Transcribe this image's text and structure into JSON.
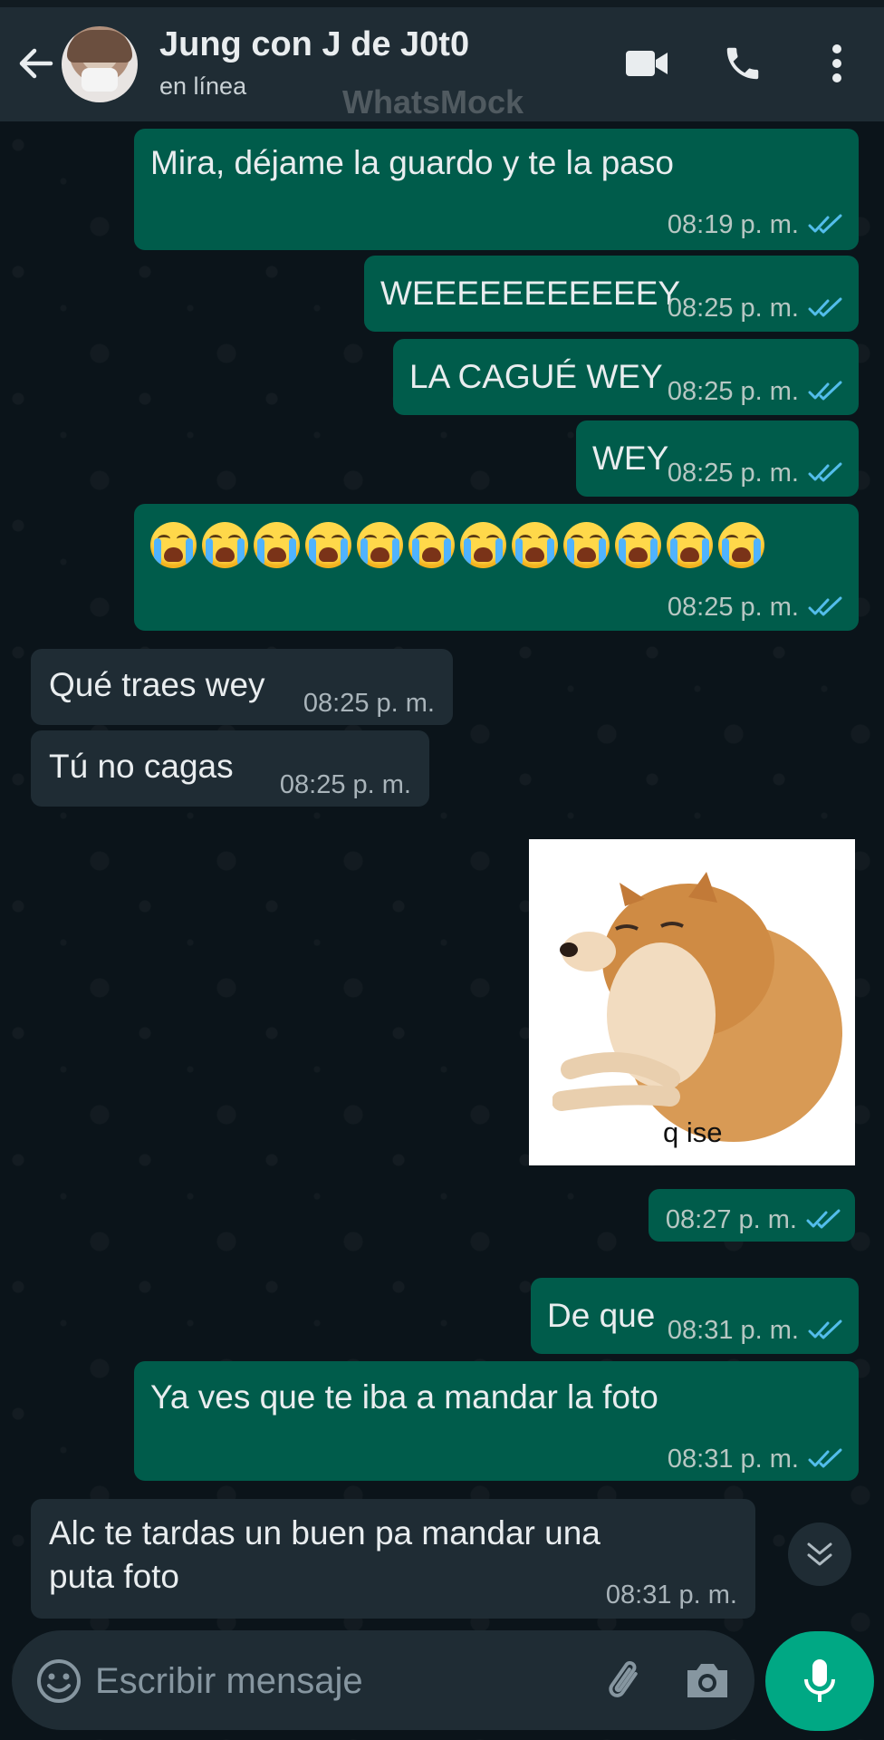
{
  "header": {
    "contact_name": "Jung con J de J0t0",
    "status": "en línea",
    "watermark": "WhatsMock"
  },
  "icons": {
    "back": "arrow-left-icon",
    "video": "video-call-icon",
    "call": "phone-icon",
    "menu": "more-vertical-icon",
    "read_receipt": "double-check-icon",
    "scroll": "chevron-double-down-icon",
    "emoji": "emoji-icon",
    "attach": "paperclip-icon",
    "camera": "camera-icon",
    "mic": "microphone-icon"
  },
  "colors": {
    "outgoing_bubble": "#005c4b",
    "incoming_bubble": "#1f2c34",
    "read_check": "#53bdeb",
    "accent": "#00a884"
  },
  "messages": [
    {
      "direction": "out",
      "text": "Mira, déjame la guardo y te la paso",
      "time": "08:19 p. m."
    },
    {
      "direction": "out",
      "text": "WEEEEEEEEEEEY",
      "time": "08:25 p. m."
    },
    {
      "direction": "out",
      "text": "LA CAGUÉ WEY",
      "time": "08:25 p. m."
    },
    {
      "direction": "out",
      "text": "WEY",
      "time": "08:25 p. m."
    },
    {
      "direction": "out",
      "emoji": "loudly-crying-face",
      "emoji_count": 12,
      "time": "08:25 p. m."
    },
    {
      "direction": "in",
      "text": "Qué traes wey",
      "time": "08:25 p. m."
    },
    {
      "direction": "in",
      "text": "Tú no cagas",
      "time": "08:25 p. m."
    },
    {
      "direction": "out",
      "image_caption": "q ise",
      "time": "08:27 p. m."
    },
    {
      "direction": "out",
      "text": "De que",
      "time": "08:31 p. m."
    },
    {
      "direction": "out",
      "text": "Ya ves que te iba a mandar la foto",
      "time": "08:31 p. m."
    },
    {
      "direction": "in",
      "text_line1": "Alc te tardas un buen pa mandar una",
      "text_line2": "puta foto",
      "time": "08:31 p. m."
    }
  ],
  "composer": {
    "placeholder": "Escribir mensaje"
  }
}
